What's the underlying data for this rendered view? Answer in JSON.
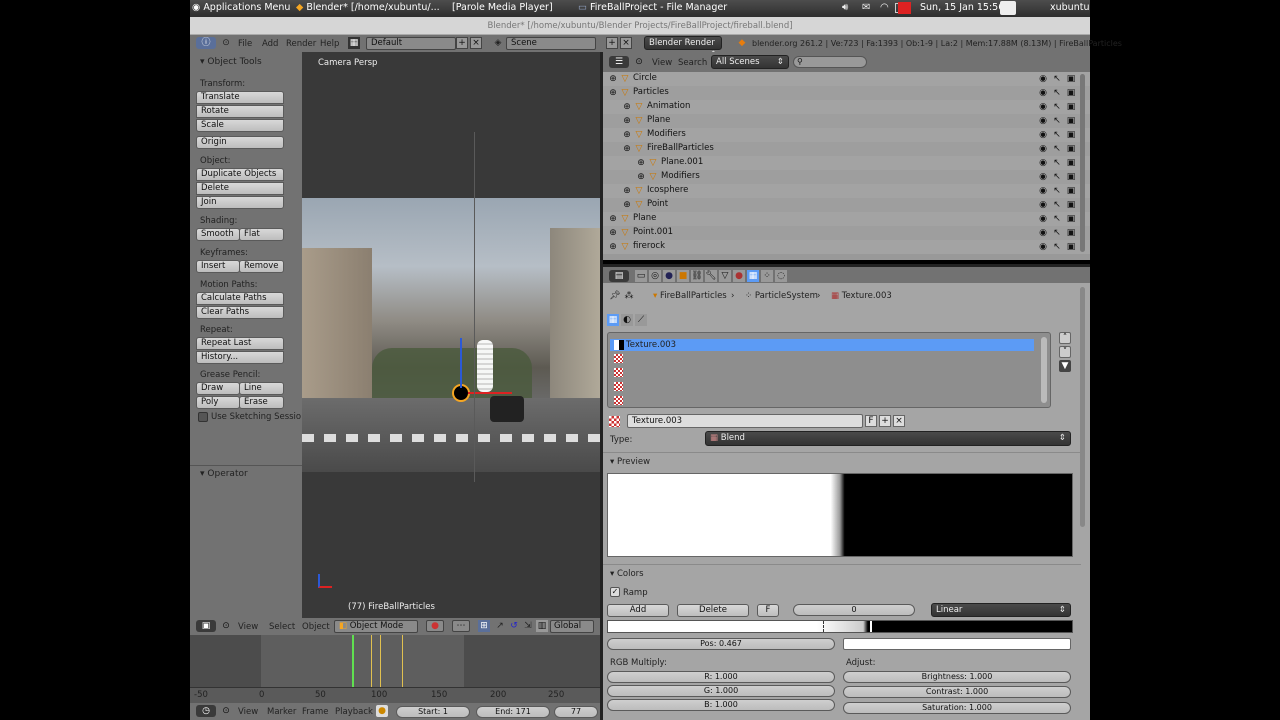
{
  "taskbar": {
    "apps_menu": "Applications Menu",
    "tasks": [
      "Blender* [/home/xubuntu/...",
      "[Parole Media Player]",
      "FireBallProject - File Manager"
    ],
    "datetime": "Sun, 15 Jan  15:56",
    "user": "xubuntu"
  },
  "window_title": "Blender* [/home/xubuntu/Blender Projects/FireBallProject/fireball.blend]",
  "info_header": {
    "menus": [
      "File",
      "Add",
      "Render",
      "Help"
    ],
    "screen": "Default",
    "scene": "Scene",
    "engine": "Blender Render",
    "stats": "blender.org 261.2 | Ve:723 | Fa:1393 | Ob:1-9 | La:2 | Mem:17.88M (8.13M) | FireBallParticles"
  },
  "tool_shelf": {
    "title": "Object Tools",
    "transform_label": "Transform:",
    "translate": "Translate",
    "rotate": "Rotate",
    "scale": "Scale",
    "origin": "Origin",
    "object_label": "Object:",
    "duplicate": "Duplicate Objects",
    "delete": "Delete",
    "join": "Join",
    "shading_label": "Shading:",
    "smooth": "Smooth",
    "flat": "Flat",
    "keyframes_label": "Keyframes:",
    "insert": "Insert",
    "remove": "Remove",
    "motion_label": "Motion Paths:",
    "calc_paths": "Calculate Paths",
    "clear_paths": "Clear Paths",
    "repeat_label": "Repeat:",
    "repeat_last": "Repeat Last",
    "history": "History...",
    "grease_label": "Grease Pencil:",
    "draw": "Draw",
    "line": "Line",
    "poly": "Poly",
    "erase": "Erase",
    "sketching": "Use Sketching Sessio",
    "operator": "Operator"
  },
  "viewport": {
    "view_name": "Camera Persp",
    "object_label": "(77) FireBallParticles",
    "menus": [
      "View",
      "Select",
      "Object"
    ],
    "mode": "Object Mode",
    "orientation": "Global"
  },
  "timeline": {
    "ticks": [
      "-50",
      "0",
      "50",
      "100",
      "150",
      "200",
      "250"
    ],
    "menus": [
      "View",
      "Marker",
      "Frame",
      "Playback"
    ],
    "start": "Start: 1",
    "end": "End: 171",
    "current": "77"
  },
  "outliner": {
    "menus": [
      "View",
      "Search"
    ],
    "scope": "All Scenes",
    "items": [
      {
        "name": "Circle",
        "indent": 0
      },
      {
        "name": "Particles",
        "indent": 0
      },
      {
        "name": "Animation",
        "indent": 1
      },
      {
        "name": "Plane",
        "indent": 1
      },
      {
        "name": "Modifiers",
        "indent": 1
      },
      {
        "name": "FireBallParticles",
        "indent": 1
      },
      {
        "name": "Plane.001",
        "indent": 2
      },
      {
        "name": "Modifiers",
        "indent": 2
      },
      {
        "name": "Icosphere",
        "indent": 1
      },
      {
        "name": "Point",
        "indent": 1
      },
      {
        "name": "Plane",
        "indent": 0
      },
      {
        "name": "Point.001",
        "indent": 0
      },
      {
        "name": "firerock",
        "indent": 0
      }
    ]
  },
  "properties": {
    "breadcrumb": [
      "FireBallParticles",
      "ParticleSystem",
      "Texture.003"
    ],
    "slot_selected": "Texture.003",
    "texture_name": "Texture.003",
    "fake_user": "F",
    "type_label": "Type:",
    "type_value": "Blend",
    "preview_label": "Preview",
    "colors_label": "Colors",
    "ramp_label": "Ramp",
    "add": "Add",
    "delete": "Delete",
    "f_btn": "F",
    "ramp_index": "0",
    "interp": "Linear",
    "pos": "Pos: 0.467",
    "rgb_label": "RGB Multiply:",
    "r": "R: 1.000",
    "g": "G: 1.000",
    "b": "B: 1.000",
    "adjust_label": "Adjust:",
    "brightness": "Brightness: 1.000",
    "contrast": "Contrast: 1.000",
    "saturation": "Saturation: 1.000"
  },
  "colors": {
    "selected": "#5c9bf5",
    "panel": "#a5a5a5",
    "header": "#727272"
  }
}
